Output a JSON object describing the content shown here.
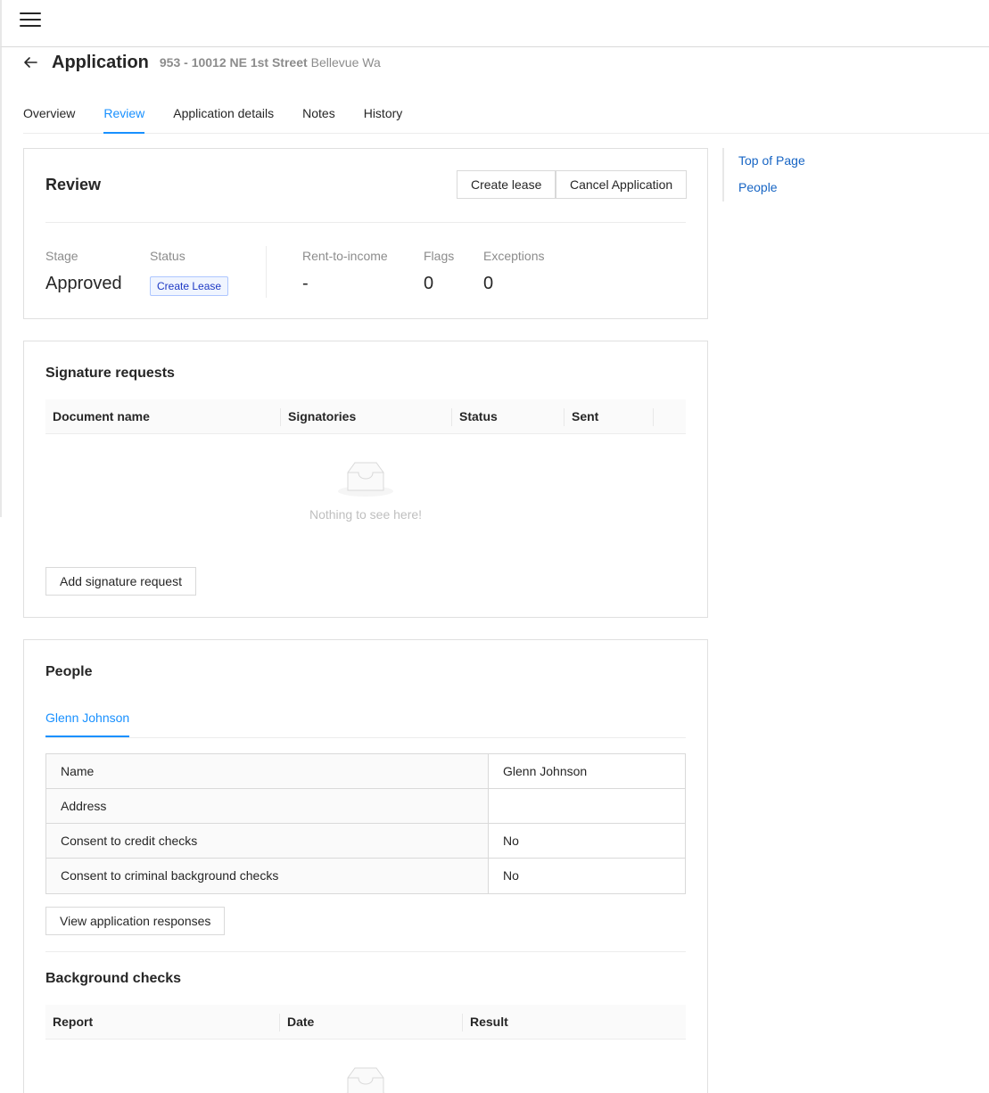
{
  "header": {
    "title": "Application",
    "address_bold": "953 - 10012 NE 1st Street",
    "address_city": "Bellevue Wa"
  },
  "tabs": [
    {
      "label": "Overview",
      "active": false
    },
    {
      "label": "Review",
      "active": true
    },
    {
      "label": "Application details",
      "active": false
    },
    {
      "label": "Notes",
      "active": false
    },
    {
      "label": "History",
      "active": false
    }
  ],
  "review": {
    "title": "Review",
    "create_lease_button": "Create lease",
    "cancel_application_button": "Cancel Application",
    "stats": {
      "stage_label": "Stage",
      "stage_value": "Approved",
      "status_label": "Status",
      "status_tag": "Create Lease",
      "rent_to_income_label": "Rent-to-income",
      "rent_to_income_value": "-",
      "flags_label": "Flags",
      "flags_value": "0",
      "exceptions_label": "Exceptions",
      "exceptions_value": "0"
    }
  },
  "signature_requests": {
    "title": "Signature requests",
    "columns": [
      "Document name",
      "Signatories",
      "Status",
      "Sent"
    ],
    "empty_text": "Nothing to see here!",
    "add_button": "Add signature request"
  },
  "people": {
    "title": "People",
    "person_tab": "Glenn Johnson",
    "rows": [
      {
        "key": "Name",
        "value": "Glenn Johnson"
      },
      {
        "key": "Address",
        "value": ""
      },
      {
        "key": "Consent to credit checks",
        "value": "No"
      },
      {
        "key": "Consent to criminal background checks",
        "value": "No"
      }
    ],
    "view_responses_button": "View application responses",
    "background_checks_title": "Background checks",
    "background_columns": [
      "Report",
      "Date",
      "Result"
    ]
  },
  "anchor_nav": {
    "top_of_page": "Top of Page",
    "people": "People"
  },
  "colors": {
    "accent": "#1890ff",
    "link": "#1765c4",
    "tag_text": "#1d39c4",
    "tag_bg": "#f0f5ff"
  }
}
